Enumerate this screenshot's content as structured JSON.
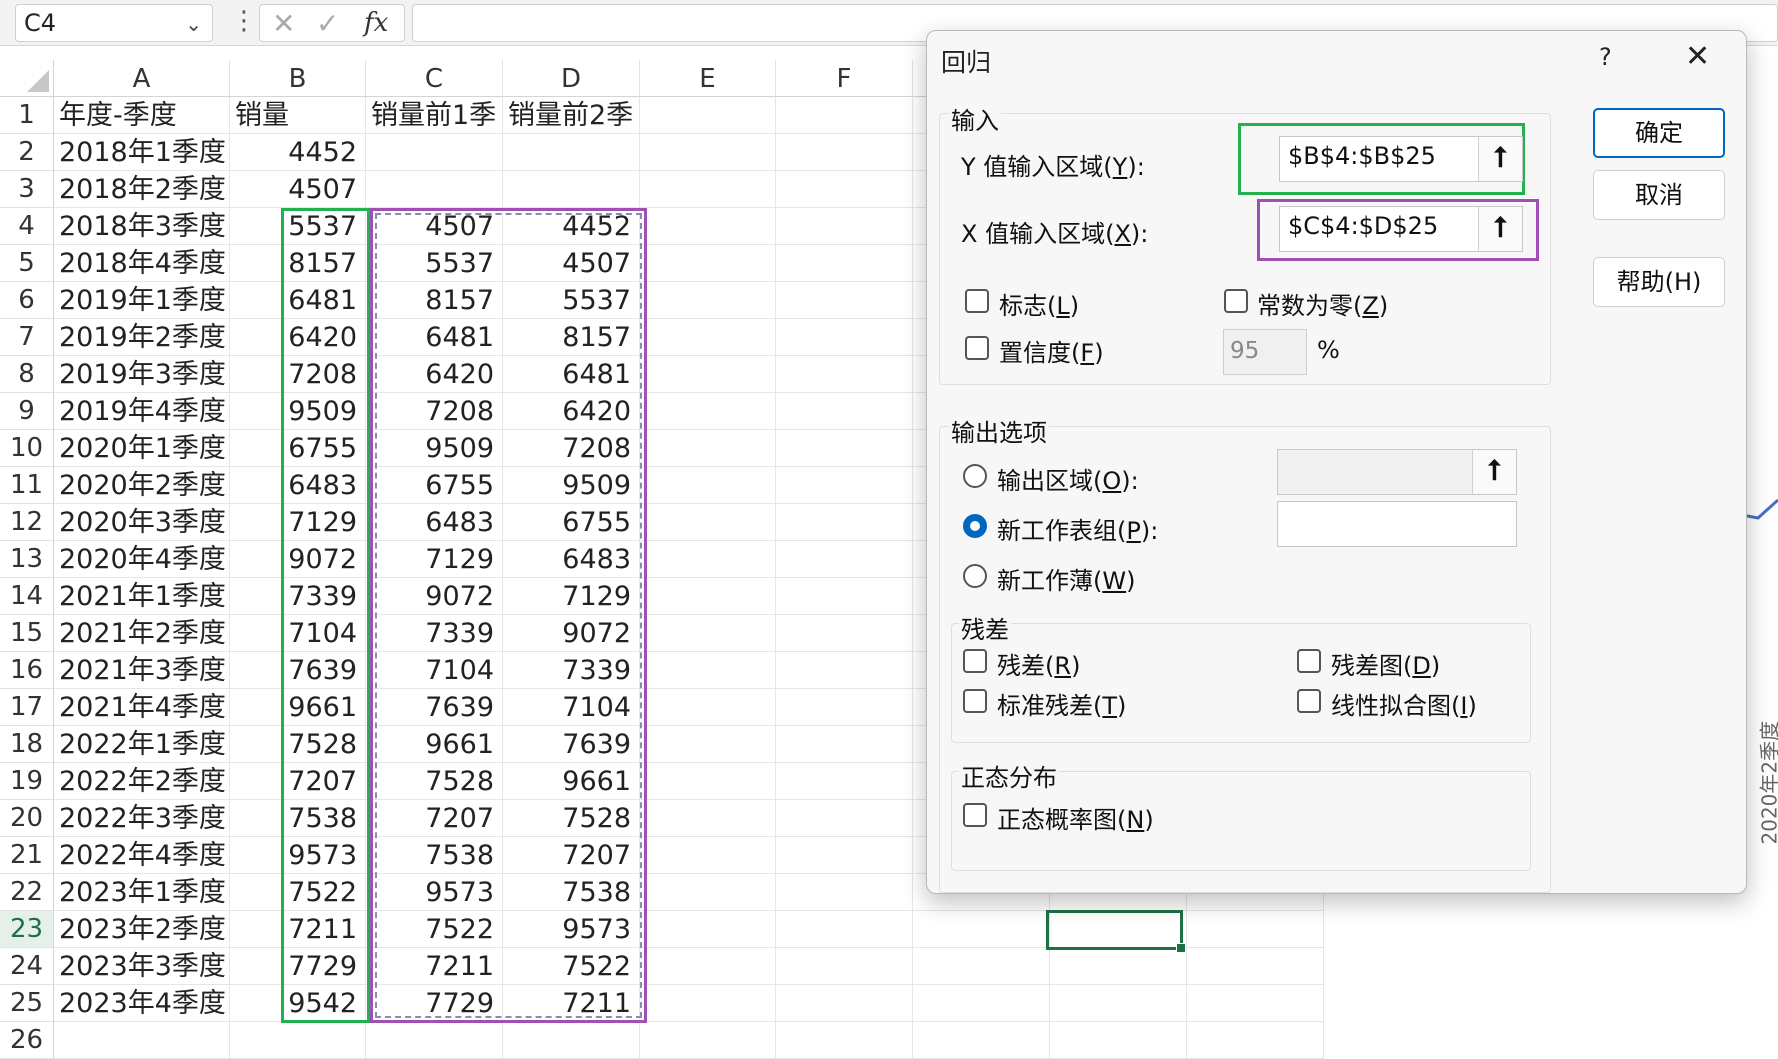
{
  "formula_bar": {
    "name_box": "C4",
    "cancel_icon": "✕",
    "enter_icon": "✓",
    "fx_label": "fx",
    "formula": ""
  },
  "columns": [
    "A",
    "B",
    "C",
    "D",
    "E",
    "F"
  ],
  "header_row": [
    "年度-季度",
    "销量",
    "销量前1季",
    "销量前2季"
  ],
  "rows": [
    [
      "2018年1季度",
      "4452",
      "",
      ""
    ],
    [
      "2018年2季度",
      "4507",
      "",
      ""
    ],
    [
      "2018年3季度",
      "5537",
      "4507",
      "4452"
    ],
    [
      "2018年4季度",
      "8157",
      "5537",
      "4507"
    ],
    [
      "2019年1季度",
      "6481",
      "8157",
      "5537"
    ],
    [
      "2019年2季度",
      "6420",
      "6481",
      "8157"
    ],
    [
      "2019年3季度",
      "7208",
      "6420",
      "6481"
    ],
    [
      "2019年4季度",
      "9509",
      "7208",
      "6420"
    ],
    [
      "2020年1季度",
      "6755",
      "9509",
      "7208"
    ],
    [
      "2020年2季度",
      "6483",
      "6755",
      "9509"
    ],
    [
      "2020年3季度",
      "7129",
      "6483",
      "6755"
    ],
    [
      "2020年4季度",
      "9072",
      "7129",
      "6483"
    ],
    [
      "2021年1季度",
      "7339",
      "9072",
      "7129"
    ],
    [
      "2021年2季度",
      "7104",
      "7339",
      "9072"
    ],
    [
      "2021年3季度",
      "7639",
      "7104",
      "7339"
    ],
    [
      "2021年4季度",
      "9661",
      "7639",
      "7104"
    ],
    [
      "2022年1季度",
      "7528",
      "9661",
      "7639"
    ],
    [
      "2022年2季度",
      "7207",
      "7528",
      "9661"
    ],
    [
      "2022年3季度",
      "7538",
      "7207",
      "7528"
    ],
    [
      "2022年4季度",
      "9573",
      "7538",
      "7207"
    ],
    [
      "2023年1季度",
      "7522",
      "9573",
      "7538"
    ],
    [
      "2023年2季度",
      "7211",
      "7522",
      "9573"
    ],
    [
      "2023年3季度",
      "7729",
      "7211",
      "7522"
    ],
    [
      "2023年4季度",
      "9542",
      "7729",
      "7211"
    ]
  ],
  "row_numbers": [
    "1",
    "2",
    "3",
    "4",
    "5",
    "6",
    "7",
    "8",
    "9",
    "10",
    "11",
    "12",
    "13",
    "14",
    "15",
    "16",
    "17",
    "18",
    "19",
    "20",
    "21",
    "22",
    "23",
    "24",
    "25",
    "26"
  ],
  "selected_row": "23",
  "chart_fragment": {
    "axis_label": "2020年2季度",
    "line_color": "#4472c4"
  },
  "dialog": {
    "title": "回归",
    "help": "?",
    "close": "✕",
    "input_group": "输入",
    "y_label": "Y 值输入区域(",
    "y_key": "Y",
    "y_suffix": "):",
    "y_value": "$B$4:$B$25",
    "x_label": "X 值输入区域(",
    "x_key": "X",
    "x_suffix": "):",
    "x_value": "$C$4:$D$25",
    "labels_cb": "标志(",
    "labels_key": "L",
    "const_zero_cb": "常数为零(",
    "const_zero_key": "Z",
    "confidence_cb": "置信度(",
    "confidence_key": "F",
    "confidence_value": "95",
    "percent": "%",
    "close_paren": ")",
    "output_group": "输出选项",
    "out_range": "输出区域(",
    "out_range_key": "O",
    "out_range_suffix": "):",
    "new_sheet": "新工作表组(",
    "new_sheet_key": "P",
    "new_sheet_suffix": "):",
    "new_book": "新工作薄(",
    "new_book_key": "W",
    "residuals_group": "残差",
    "residuals_cb": "残差(",
    "residuals_key": "R",
    "residual_plots_cb": "残差图(",
    "residual_plots_key": "D",
    "std_residuals_cb": "标准残差(",
    "std_residuals_key": "T",
    "line_fit_cb": "线性拟合图(",
    "line_fit_key": "I",
    "normal_group": "正态分布",
    "normal_plot_cb": "正态概率图(",
    "normal_plot_key": "N",
    "ok": "确定",
    "cancel": "取消",
    "help_btn": "帮助(H)",
    "upload_icon": "🡅"
  },
  "colors": {
    "y_highlight": "#22b14c",
    "x_highlight": "#a04fb5",
    "accent": "#0067c0",
    "active_cell": "#1e7145"
  }
}
